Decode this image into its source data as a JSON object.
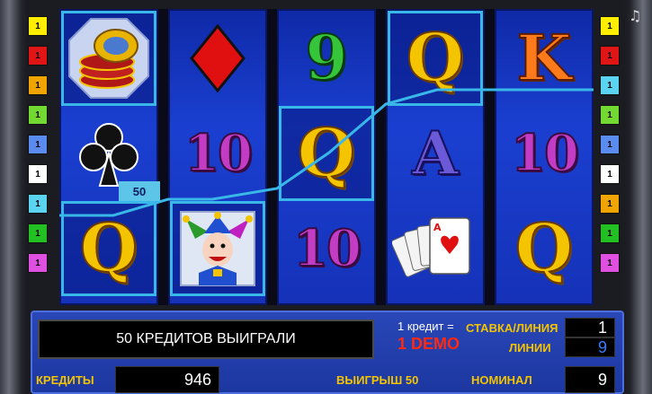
{
  "colors": {
    "highlight_line": "#39b7e8",
    "reel_blue": "#1a3fd0",
    "gold": "#f4c400",
    "demo_red": "#ff2a10"
  },
  "line_buttons_left": [
    {
      "label": "1",
      "color": "#ffee00"
    },
    {
      "label": "1",
      "color": "#e01616"
    },
    {
      "label": "1",
      "color": "#f0a400"
    },
    {
      "label": "1",
      "color": "#72d832"
    },
    {
      "label": "1",
      "color": "#5a8cf0"
    },
    {
      "label": "1",
      "color": "#ffffff"
    },
    {
      "label": "1",
      "color": "#5ad4f0"
    },
    {
      "label": "1",
      "color": "#22c022"
    },
    {
      "label": "1",
      "color": "#e050e0"
    }
  ],
  "line_buttons_right": [
    {
      "label": "1",
      "color": "#ffee00"
    },
    {
      "label": "1",
      "color": "#e01616"
    },
    {
      "label": "1",
      "color": "#5ad4f0"
    },
    {
      "label": "1",
      "color": "#72d832"
    },
    {
      "label": "1",
      "color": "#5a8cf0"
    },
    {
      "label": "1",
      "color": "#ffffff"
    },
    {
      "label": "1",
      "color": "#f0a400"
    },
    {
      "label": "1",
      "color": "#22c022"
    },
    {
      "label": "1",
      "color": "#e050e0"
    }
  ],
  "reels": [
    [
      "coins-symbol",
      "club-symbol",
      "queen-symbol"
    ],
    [
      "diamond-symbol",
      "ten-symbol",
      "jester-symbol"
    ],
    [
      "nine-symbol",
      "queen-symbol",
      "ten-symbol"
    ],
    [
      "queen-symbol",
      "ace-symbol",
      "cards-symbol"
    ],
    [
      "king-symbol",
      "ten-symbol",
      "queen-symbol"
    ]
  ],
  "symbol_text": {
    "queen": "Q",
    "king": "K",
    "ace": "A",
    "ten": "10",
    "nine": "9"
  },
  "win_badge": "50",
  "hud": {
    "message": "50 КРЕДИТОВ ВЫИГРАЛИ",
    "credit_eq": "1 кредит =",
    "bet_per_line_label": "СТАВКА/ЛИНИЯ",
    "demo_label": "1 DEMO",
    "lines_label": "ЛИНИИ",
    "bet_value": "1",
    "lines_value": "9",
    "credits_label": "КРЕДИТЫ",
    "credits_value": "946",
    "win_label": "ВЫИГРЫШ 50",
    "denom_label": "НОМИНАЛ",
    "denom_value": "9"
  },
  "corner_icon": "music-note-icon"
}
